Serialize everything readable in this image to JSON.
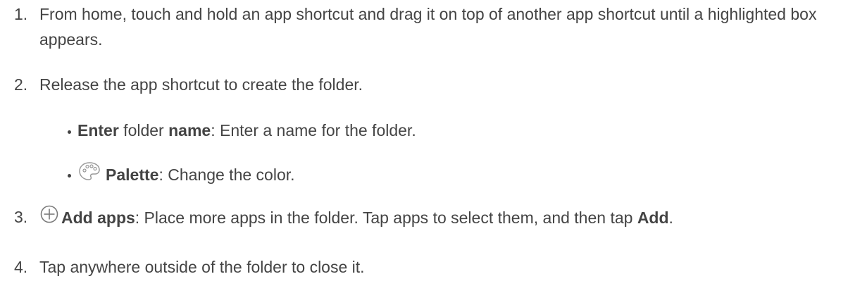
{
  "steps": [
    {
      "number": "1.",
      "text": "From home, touch and hold an app shortcut and drag it on top of another app shortcut until a highlighted box appears."
    },
    {
      "number": "2.",
      "text": "Release the app shortcut to create the folder.",
      "bullets": [
        {
          "bold1": "Enter",
          "plain1": " folder ",
          "bold2": "name",
          "rest": ": Enter a name for the folder."
        },
        {
          "icon": "palette-icon",
          "bold": "Palette",
          "rest": ": Change the color."
        }
      ]
    },
    {
      "number": "3.",
      "icon": "add-circle-icon",
      "bold": "Add apps",
      "rest": ": Place more apps in the folder. Tap apps to select them, and then tap ",
      "bold_end": "Add",
      "end": "."
    },
    {
      "number": "4.",
      "text": "Tap anywhere outside of the folder to close it."
    }
  ]
}
